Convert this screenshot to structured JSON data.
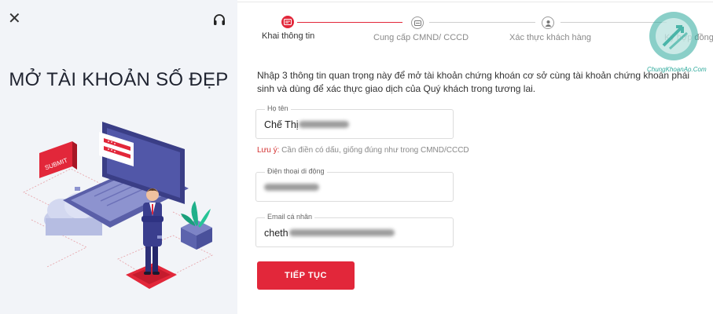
{
  "header": {
    "title": "MỞ TÀI KHOẢN SỐ ĐẸP",
    "close_icon": "close-icon",
    "support_icon": "headset-icon"
  },
  "steps": [
    {
      "label": "Khai thông tin",
      "icon": "id-card-icon",
      "active": true
    },
    {
      "label": "Cung cấp CMND/ CCCD",
      "icon": "id-card-icon",
      "active": false
    },
    {
      "label": "Xác thực khách hàng",
      "icon": "user-icon",
      "active": false
    },
    {
      "label": "Ký hợp đồng",
      "icon": "contract-icon",
      "active": false
    }
  ],
  "form": {
    "intro": "Nhập 3 thông tin quan trọng này để mở tài khoản chứng khoán cơ sở cùng tài khoản chứng khoán phái sinh và dùng để xác thực giao dịch của Quý khách trong tương lai.",
    "name_label": "Họ tên",
    "name_value": "Chế Thị",
    "note_label": "Lưu ý:",
    "note_text": "Cần điền có dấu, giống đúng như trong CMND/CCCD",
    "phone_label": "Điện thoại di động",
    "phone_value": "",
    "email_label": "Email cá nhân",
    "email_value": "cheth",
    "submit_label": "TIẾP TỤC"
  },
  "illustration": {
    "submit_badge": "SUBMIT"
  },
  "watermark": {
    "text": "ChungKhoanAo.Com"
  },
  "colors": {
    "accent": "#e2273a",
    "left_bg": "#f2f4f8",
    "watermark": "#2aa89a"
  }
}
